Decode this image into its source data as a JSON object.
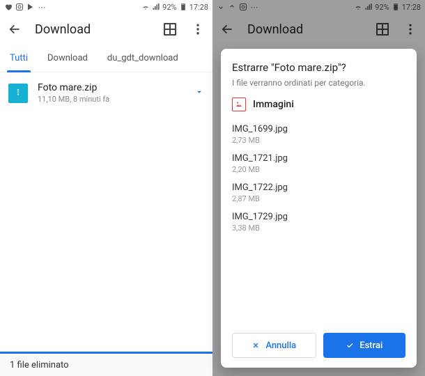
{
  "statusbar": {
    "battery": "92%",
    "time": "17:28"
  },
  "left": {
    "appbar": {
      "title": "Download"
    },
    "tabs": [
      {
        "label": "Tutti",
        "active": true
      },
      {
        "label": "Download",
        "active": false
      },
      {
        "label": "du_gdt_download",
        "active": false
      }
    ],
    "file": {
      "name": "Foto mare.zip",
      "meta": "11,10 MB, 8 minuti fa"
    },
    "snackbar": "1 file eliminato"
  },
  "right": {
    "appbar": {
      "title": "Download"
    },
    "dialog": {
      "title": "Estrarre \"Foto mare.zip\"?",
      "subtitle": "I file verranno ordinati per categoria.",
      "category": "Immagini",
      "files": [
        {
          "name": "IMG_1699.jpg",
          "size": "2,73 MB"
        },
        {
          "name": "IMG_1721.jpg",
          "size": "2,20 MB"
        },
        {
          "name": "IMG_1722.jpg",
          "size": "2,87 MB"
        },
        {
          "name": "IMG_1729.jpg",
          "size": "3,38 MB"
        }
      ],
      "cancel": "Annulla",
      "confirm": "Estrai"
    }
  }
}
